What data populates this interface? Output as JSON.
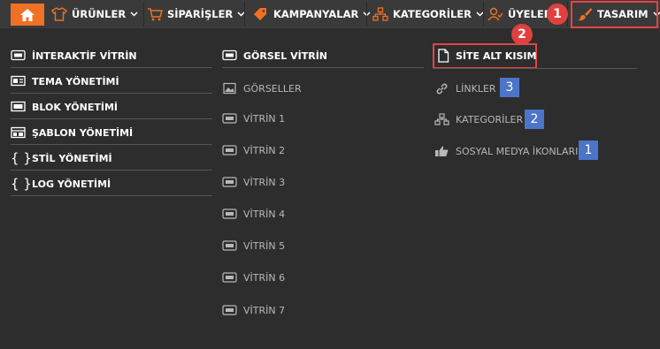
{
  "nav": {
    "urunler": "ÜRÜNLER",
    "siparisler": "SİPARİŞLER",
    "kampanyalar": "KAMPANYALAR",
    "kategoriler": "KATEGORİLER",
    "uyeler": "ÜYELER",
    "tasarim": "TASARIM"
  },
  "annotations": {
    "badge1": "1",
    "badge2": "2",
    "blue3": "3",
    "blue2": "2",
    "blue1": "1"
  },
  "col1": [
    "İNTERAKTİF VİTRİN",
    "TEMA YÖNETİMİ",
    "BLOK YÖNETİMİ",
    "ŞABLON YÖNETİMİ",
    "STİL YÖNETİMİ",
    "LOG YÖNETİMİ"
  ],
  "col2": {
    "header": "GÖRSEL VİTRİN",
    "items": [
      "GÖRSELLER",
      "VİTRİN 1",
      "VİTRİN 2",
      "VİTRİN 3",
      "VİTRİN 4",
      "VİTRİN 5",
      "VİTRİN 6",
      "VİTRİN 7"
    ]
  },
  "col3": {
    "header": "SİTE ALT KISIM",
    "items": [
      "LİNKLER",
      "KATEGORİLER",
      "SOSYAL MEDYA İKONLARI"
    ]
  },
  "colors": {
    "accent": "#f07124",
    "annotation_red": "#e24444",
    "annotation_blue": "#4c74c8"
  }
}
